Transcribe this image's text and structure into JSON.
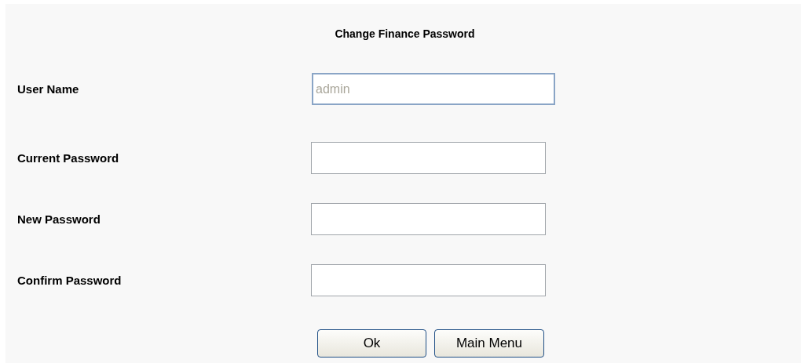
{
  "form": {
    "title": "Change Finance Password",
    "fields": [
      {
        "label": "User Name",
        "value": "admin",
        "disabled": true
      },
      {
        "label": "Current Password",
        "disabled": false
      },
      {
        "label": "New Password",
        "disabled": false
      },
      {
        "label": "Confirm Password",
        "disabled": false
      }
    ],
    "buttons": [
      "Ok",
      "Main Menu"
    ]
  }
}
